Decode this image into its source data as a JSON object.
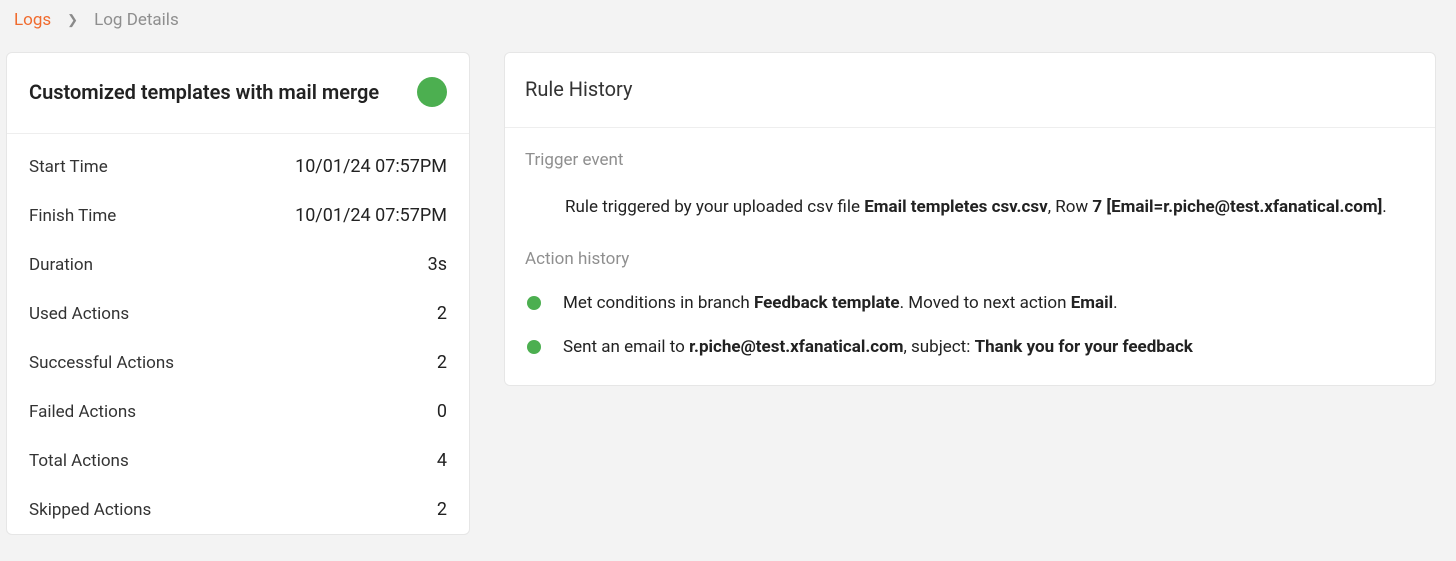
{
  "breadcrumb": {
    "parent": "Logs",
    "current": "Log Details"
  },
  "summary": {
    "title": "Customized templates with mail merge",
    "status": "success",
    "rows": [
      {
        "label": "Start Time",
        "value": "10/01/24 07:57PM"
      },
      {
        "label": "Finish Time",
        "value": "10/01/24 07:57PM"
      },
      {
        "label": "Duration",
        "value": "3s"
      },
      {
        "label": "Used Actions",
        "value": "2"
      },
      {
        "label": "Successful Actions",
        "value": "2"
      },
      {
        "label": "Failed Actions",
        "value": "0"
      },
      {
        "label": "Total Actions",
        "value": "4"
      },
      {
        "label": "Skipped Actions",
        "value": "2"
      }
    ]
  },
  "history": {
    "title": "Rule History",
    "trigger_label": "Trigger event",
    "trigger": {
      "prefix": "Rule triggered by your uploaded csv file ",
      "filename": "Email templetes csv.csv",
      "mid": ", Row ",
      "row_detail": "7 [Email=r.piche@test.xfanatical.com]",
      "suffix": "."
    },
    "action_label": "Action history",
    "actions": [
      {
        "p1": "Met conditions in branch ",
        "b1": "Feedback template",
        "p2": ". Moved to next action ",
        "b2": "Email",
        "p3": "."
      },
      {
        "p1": "Sent an email to ",
        "b1": "r.piche@test.xfanatical.com",
        "p2": ", subject: ",
        "b2": "Thank you for your feedback",
        "p3": ""
      }
    ]
  }
}
